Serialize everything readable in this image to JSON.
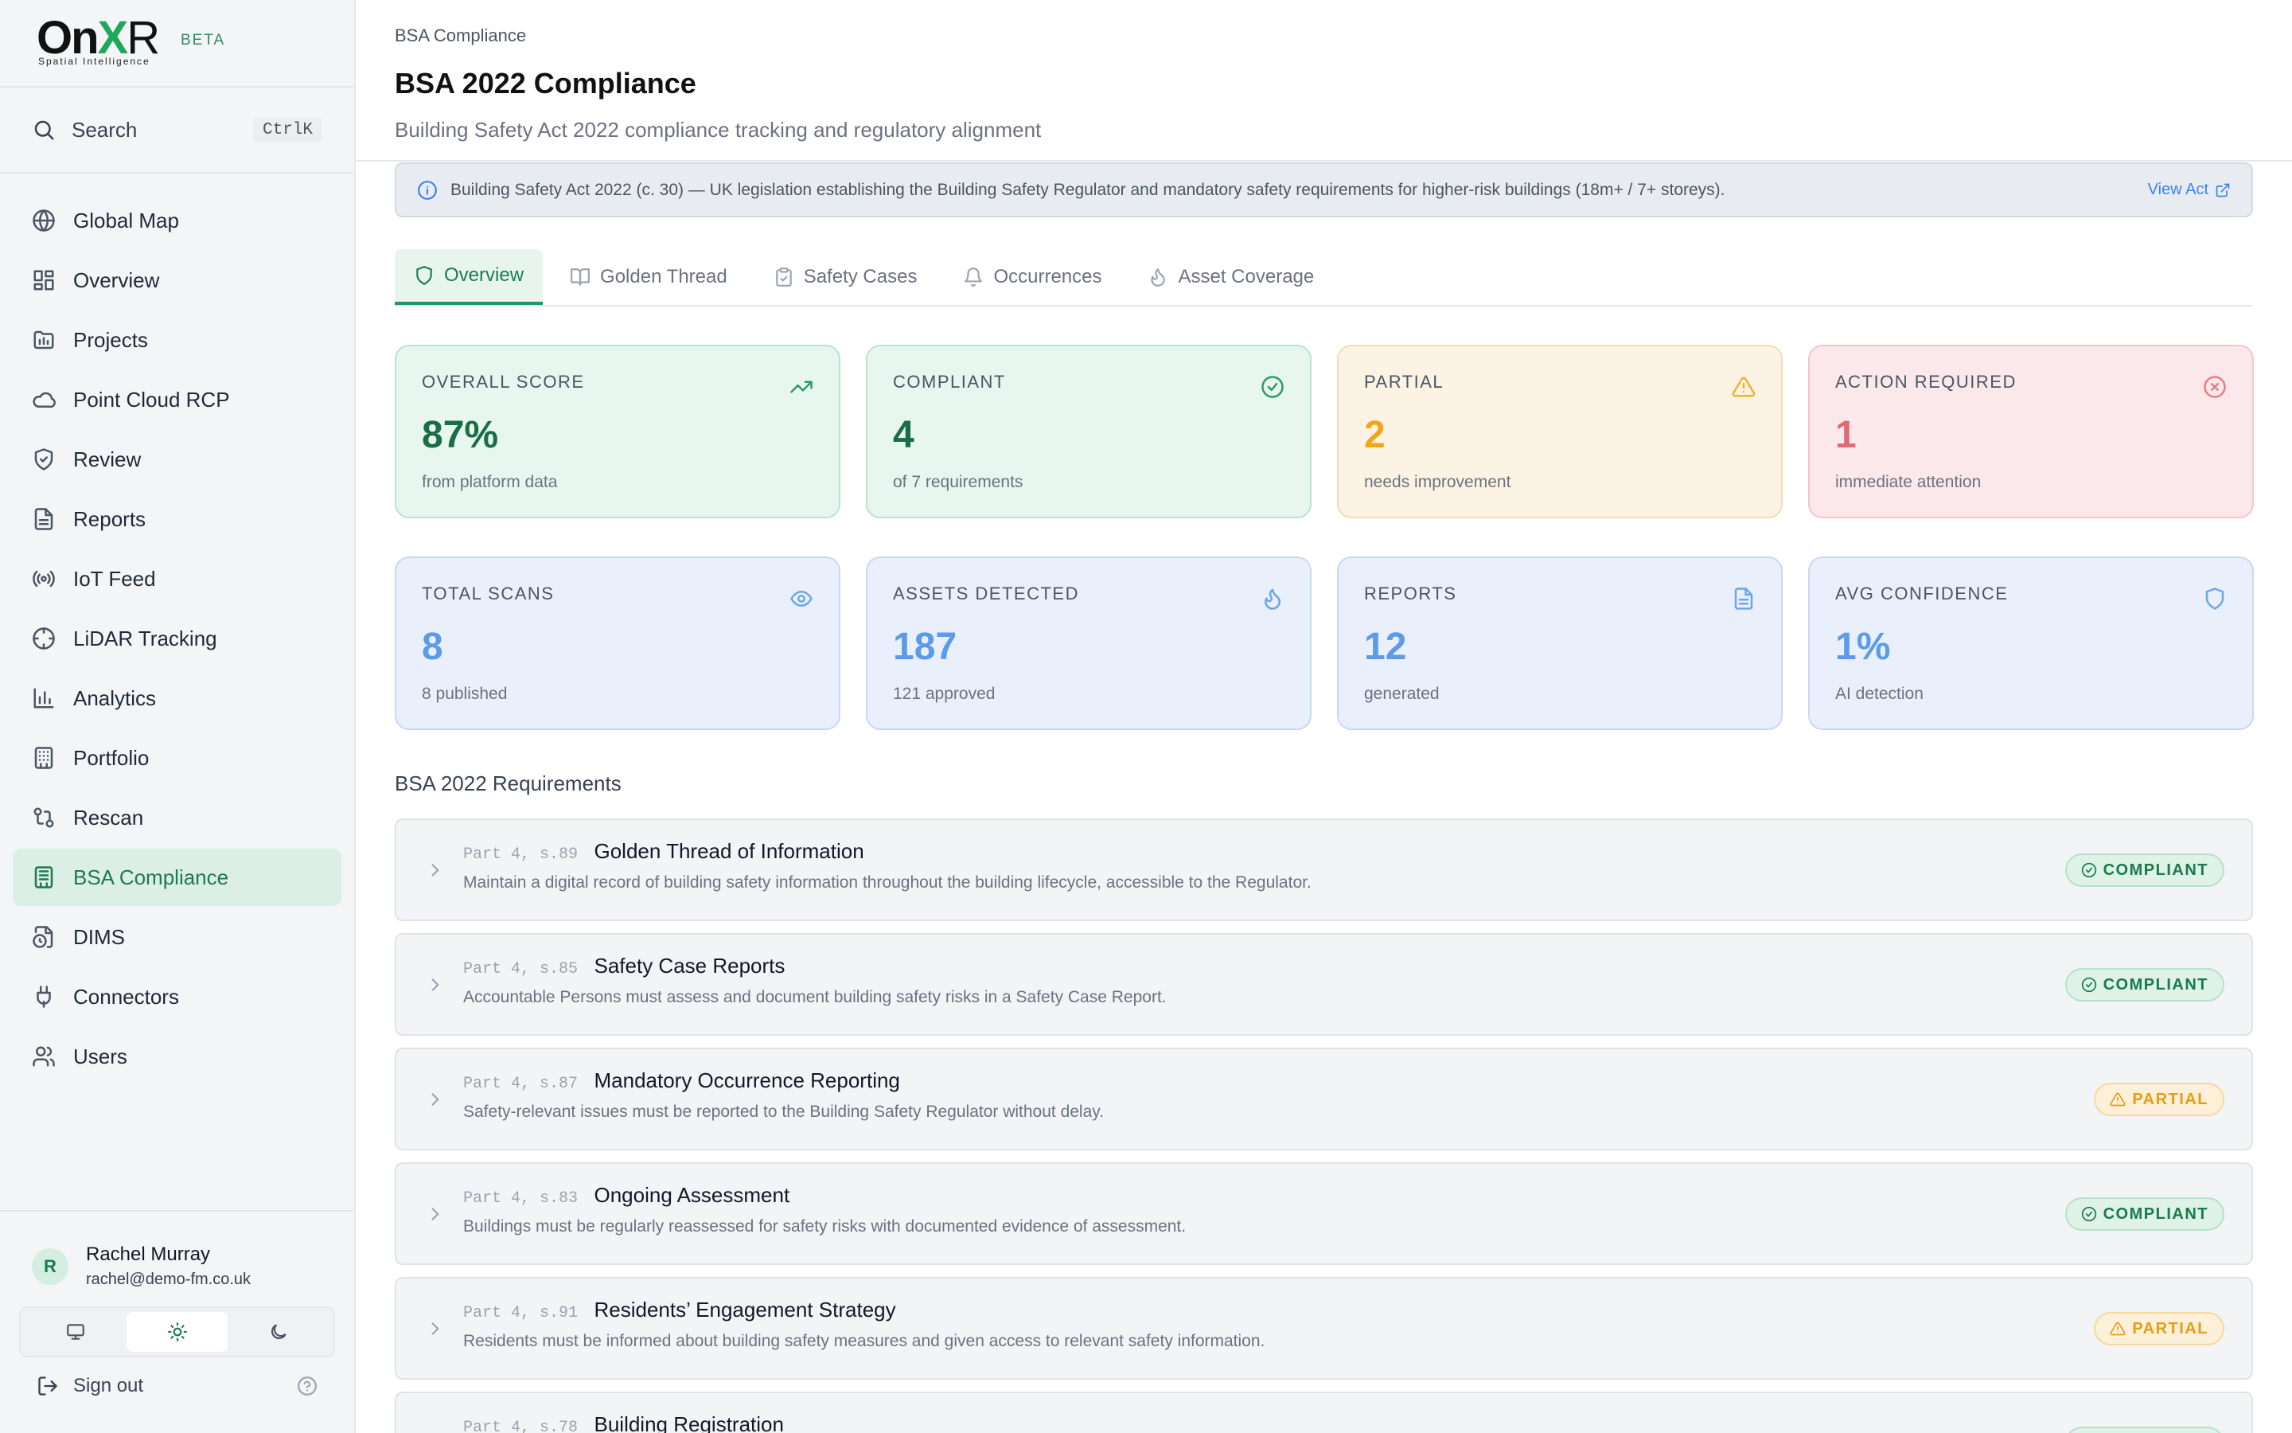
{
  "brand": {
    "logo_main": "On",
    "logo_x": "X",
    "logo_r": "R",
    "logo_sub": "Spatial Intelligence",
    "beta": "BETA"
  },
  "search": {
    "label": "Search",
    "shortcut": "CtrlK"
  },
  "nav": [
    {
      "label": "Global Map",
      "icon": "globe-icon"
    },
    {
      "label": "Overview",
      "icon": "dashboard-icon"
    },
    {
      "label": "Projects",
      "icon": "folder-chart-icon"
    },
    {
      "label": "Point Cloud RCP",
      "icon": "cloud-icon"
    },
    {
      "label": "Review",
      "icon": "shield-check-icon"
    },
    {
      "label": "Reports",
      "icon": "file-text-icon"
    },
    {
      "label": "IoT Feed",
      "icon": "radio-icon"
    },
    {
      "label": "LiDAR Tracking",
      "icon": "crosshair-icon"
    },
    {
      "label": "Analytics",
      "icon": "bar-chart-icon"
    },
    {
      "label": "Portfolio",
      "icon": "building-icon"
    },
    {
      "label": "Rescan",
      "icon": "git-compare-icon"
    },
    {
      "label": "BSA Compliance",
      "icon": "building-check-icon",
      "active": true
    },
    {
      "label": "DIMS",
      "icon": "file-clock-icon"
    },
    {
      "label": "Connectors",
      "icon": "plug-icon"
    },
    {
      "label": "Users",
      "icon": "users-icon"
    }
  ],
  "user": {
    "initial": "R",
    "name": "Rachel Murray",
    "email": "rachel@demo-fm.co.uk"
  },
  "theme": {
    "options": [
      "monitor-icon",
      "sun-icon",
      "moon-icon"
    ],
    "selected": "sun-icon"
  },
  "signout": {
    "label": "Sign out"
  },
  "header": {
    "breadcrumb": "BSA Compliance",
    "title": "BSA 2022 Compliance",
    "subtitle": "Building Safety Act 2022 compliance tracking and regulatory alignment"
  },
  "info": {
    "text": "Building Safety Act 2022 (c. 30) — UK legislation establishing the Building Safety Regulator and mandatory safety requirements for higher-risk buildings (18m+ / 7+ storeys).",
    "link": "View Act"
  },
  "tabs": [
    {
      "label": "Overview",
      "icon": "shield-icon",
      "active": true
    },
    {
      "label": "Golden Thread",
      "icon": "book-open-icon"
    },
    {
      "label": "Safety Cases",
      "icon": "clipboard-check-icon"
    },
    {
      "label": "Occurrences",
      "icon": "bell-icon"
    },
    {
      "label": "Asset Coverage",
      "icon": "flame-icon"
    }
  ],
  "stats_row1": [
    {
      "label": "OVERALL SCORE",
      "value": "87%",
      "sub": "from platform data",
      "tone": "green",
      "icon": "trending-up-icon"
    },
    {
      "label": "COMPLIANT",
      "value": "4",
      "sub": "of 7 requirements",
      "tone": "green",
      "icon": "check-circle-icon"
    },
    {
      "label": "PARTIAL",
      "value": "2",
      "sub": "needs improvement",
      "tone": "amber",
      "icon": "alert-triangle-icon"
    },
    {
      "label": "ACTION REQUIRED",
      "value": "1",
      "sub": "immediate attention",
      "tone": "red",
      "icon": "x-circle-icon"
    }
  ],
  "stats_row2": [
    {
      "label": "TOTAL SCANS",
      "value": "8",
      "sub": "8 published",
      "tone": "blue",
      "icon": "eye-icon"
    },
    {
      "label": "ASSETS DETECTED",
      "value": "187",
      "sub": "121 approved",
      "tone": "blue",
      "icon": "flame-icon"
    },
    {
      "label": "REPORTS",
      "value": "12",
      "sub": "generated",
      "tone": "blue",
      "icon": "file-text-icon"
    },
    {
      "label": "AVG CONFIDENCE",
      "value": "1%",
      "sub": "AI detection",
      "tone": "blue",
      "icon": "shield-icon"
    }
  ],
  "requirements_title": "BSA 2022 Requirements",
  "requirements": [
    {
      "ref": "Part 4, s.89",
      "title": "Golden Thread of Information",
      "desc": "Maintain a digital record of building safety information throughout the building lifecycle, accessible to the Regulator.",
      "status": "COMPLIANT"
    },
    {
      "ref": "Part 4, s.85",
      "title": "Safety Case Reports",
      "desc": "Accountable Persons must assess and document building safety risks in a Safety Case Report.",
      "status": "COMPLIANT"
    },
    {
      "ref": "Part 4, s.87",
      "title": "Mandatory Occurrence Reporting",
      "desc": "Safety-relevant issues must be reported to the Building Safety Regulator without delay.",
      "status": "PARTIAL"
    },
    {
      "ref": "Part 4, s.83",
      "title": "Ongoing Assessment",
      "desc": "Buildings must be regularly reassessed for safety risks with documented evidence of assessment.",
      "status": "COMPLIANT"
    },
    {
      "ref": "Part 4, s.91",
      "title": "Residents’ Engagement Strategy",
      "desc": "Residents must be informed about building safety measures and given access to relevant safety information.",
      "status": "PARTIAL"
    },
    {
      "ref": "Part 4, s.78",
      "title": "Building Registration",
      "desc": "",
      "status": "COMPLIANT"
    }
  ],
  "colors": {
    "accent": "#1d7a52",
    "brand_x": "#1ea85a",
    "info_link": "#3b82f6"
  }
}
